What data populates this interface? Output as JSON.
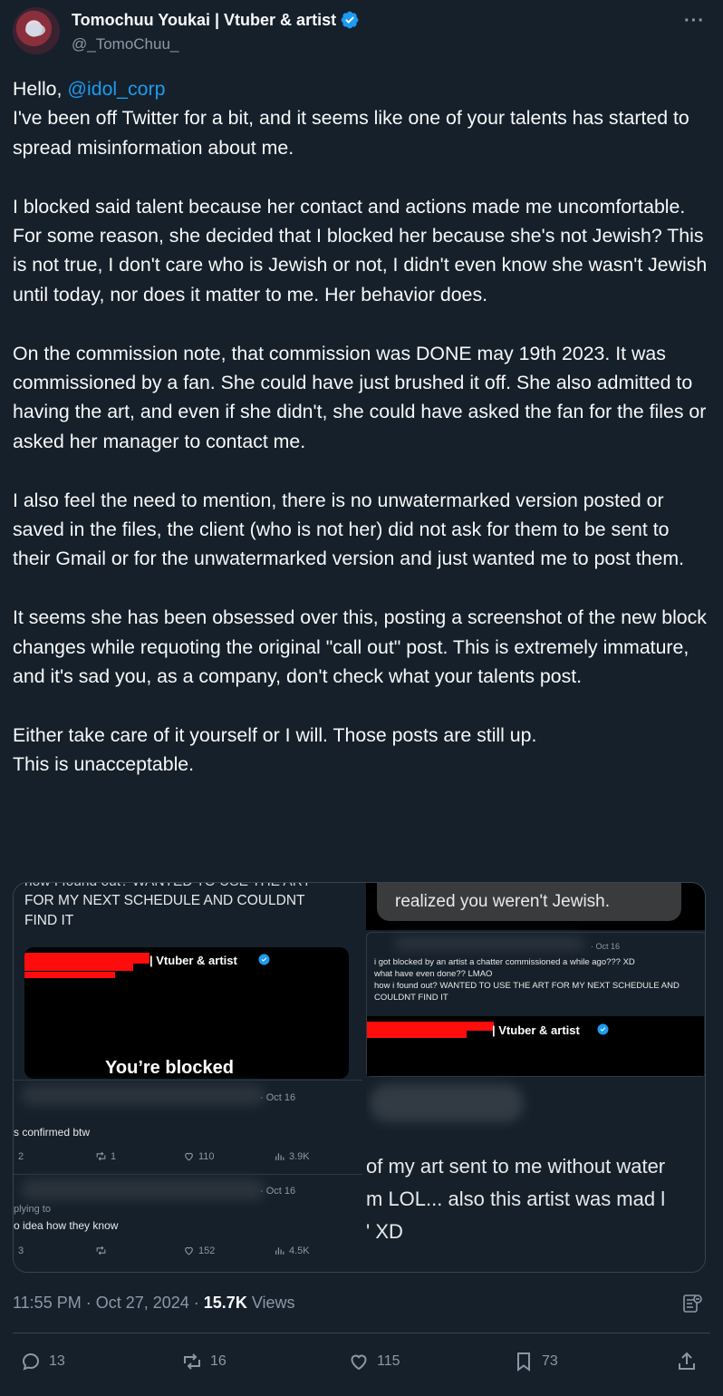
{
  "author": {
    "display_name": "Tomochuu Youkai | Vtuber & artist",
    "handle": "@_TomoChuu_",
    "verified": true
  },
  "more_icon": "more-horizontal-icon",
  "tweet": {
    "greeting": "Hello, ",
    "mention": "@idol_corp",
    "paragraphs": [
      "I've been off Twitter for a bit, and it seems like one of your talents has started to spread misinformation about me.",
      "I blocked said talent because her contact and actions made me uncomfortable. For some reason, she decided that I blocked her because she's not Jewish? This is not true, I don't care who is Jewish or not, I didn't even know she wasn't Jewish until today, nor does it matter to me. Her behavior does.",
      "On the commission note, that commission was DONE may 19th 2023. It was commissioned by a fan.  She could have just brushed it off. She also admitted to having the art, and even if she didn't, she could have asked the fan for the files or asked her manager to contact me.",
      "I also feel the need to mention, there is no unwatermarked version posted or saved in the files, the client (who is not her) did not ask for them to be sent to their Gmail or for the unwatermarked version and just wanted me to post them.",
      "It seems she has been obsessed over this, posting a screenshot of the new block changes while requoting the original \"call out\" post. This is extremely immature, and it's sad you, as a company, don't check what your talents post.",
      "Either take care of it yourself or I will. Those posts are still up.",
      "This is unacceptable."
    ]
  },
  "media": {
    "left": {
      "cut_top": "how I found out? WANTED TO USE THE ART",
      "line1": "FOR MY NEXT SCHEDULE AND COULDNT",
      "line2": "FIND IT",
      "card_name": "| Vtuber & artist",
      "blocked": "You’re blocked",
      "reply1": {
        "date": "· Oct 16",
        "text": "s confirmed btw",
        "replies": "2",
        "retweets": "1",
        "likes": "110",
        "views": "3.9K"
      },
      "reply2": {
        "date": "· Oct 16",
        "replying": "plying to",
        "text": "o idea how they know",
        "replies": "3",
        "retweets": "",
        "likes": "152",
        "views": "4.5K"
      }
    },
    "right": {
      "bubble": "realized you weren't Jewish.",
      "date": "· Oct 16",
      "q1": "i got blocked by an artist a chatter commissioned a while ago??? XD",
      "q2": "what have even done?? LMAO",
      "q3": "how i found out? WANTED TO USE THE ART FOR MY NEXT SCHEDULE AND",
      "q4": "COULDNT FIND IT",
      "card_name": "| Vtuber & artist",
      "big1": "of my art sent to me without water",
      "big2": "m LOL... also this artist was mad l",
      "big3": "' XD"
    }
  },
  "footer": {
    "time": "11:55 PM · Oct 27, 2024 · ",
    "views_count": "15.7K",
    "views_label": " Views"
  },
  "actions": {
    "replies": "13",
    "retweets": "16",
    "likes": "115",
    "bookmarks": "73"
  },
  "colors": {
    "background": "#15202b",
    "accent": "#1d9bf0",
    "muted": "#8b98a5"
  }
}
